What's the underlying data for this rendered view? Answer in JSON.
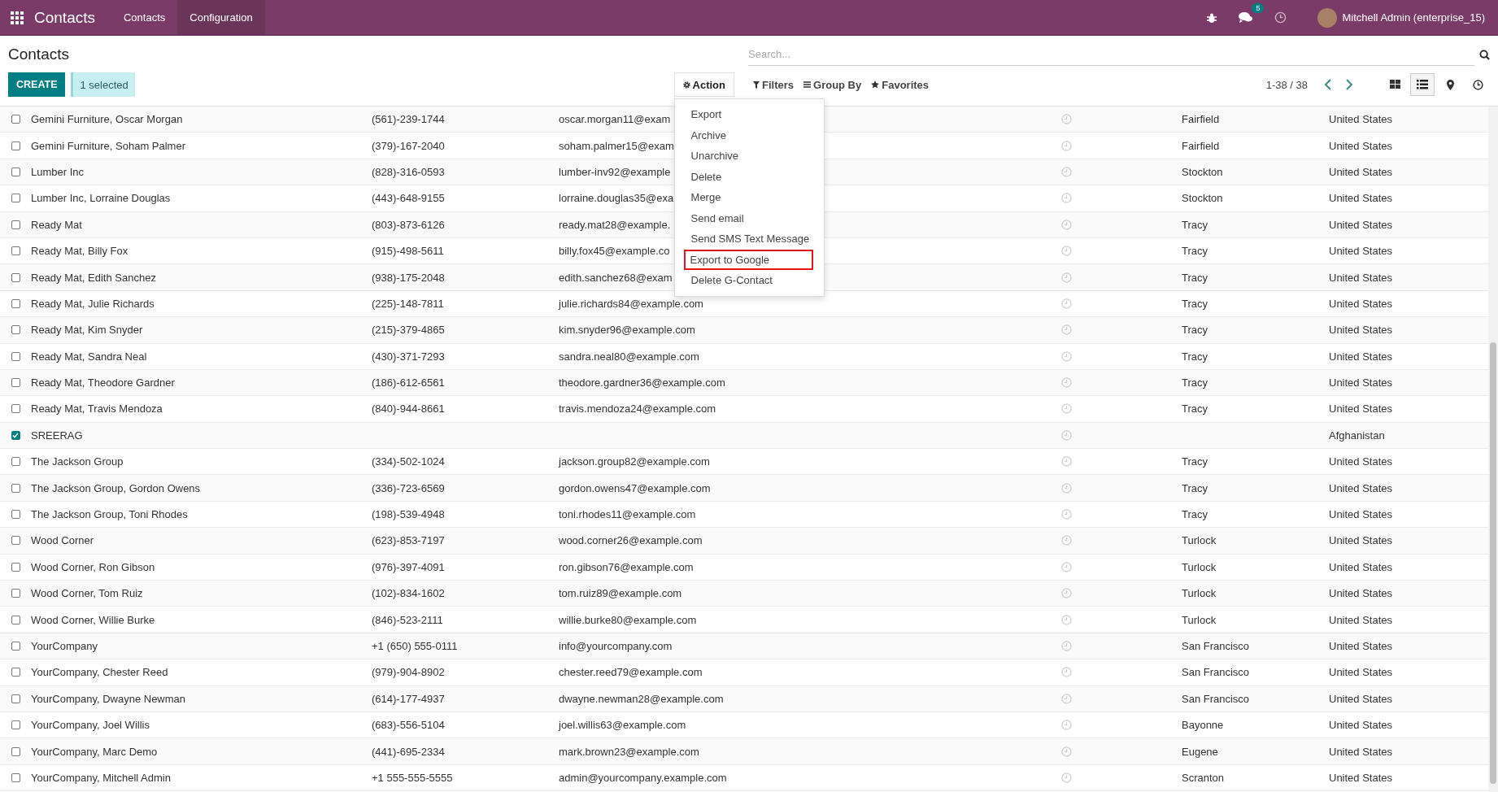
{
  "navbar": {
    "app_title": "Contacts",
    "menu": [
      {
        "label": "Contacts",
        "selected": false
      },
      {
        "label": "Configuration",
        "selected": true
      }
    ],
    "messages_badge": "5",
    "user_name": "Mitchell Admin (enterprise_15)"
  },
  "control_panel": {
    "title": "Contacts",
    "create_button": "CREATE",
    "selection": "1 selected",
    "action_button": "Action",
    "search": {
      "placeholder": "Search..."
    },
    "filters": [
      "Filters",
      "Group By",
      "Favorites"
    ],
    "pager": "1-38 / 38",
    "views": [
      {
        "kind": "kanban",
        "selected": false
      },
      {
        "kind": "list",
        "selected": true
      },
      {
        "kind": "map",
        "selected": false
      },
      {
        "kind": "activity",
        "selected": false
      }
    ]
  },
  "action_menu": {
    "items": [
      {
        "label": "Export",
        "highlighted": false
      },
      {
        "label": "Archive",
        "highlighted": false
      },
      {
        "label": "Unarchive",
        "highlighted": false
      },
      {
        "label": "Delete",
        "highlighted": false
      },
      {
        "label": "Merge",
        "highlighted": false
      },
      {
        "label": "Send email",
        "highlighted": false
      },
      {
        "label": "Send SMS Text Message",
        "highlighted": false
      },
      {
        "label": "Export to Google",
        "highlighted": true
      },
      {
        "label": "Delete G-Contact",
        "highlighted": false
      }
    ]
  },
  "table": {
    "rows": [
      {
        "checked": false,
        "name": "Gemini Furniture, Oscar Morgan",
        "phone": "(561)-239-1744",
        "email": "oscar.morgan11@exam",
        "city": "Fairfield",
        "country": "United States"
      },
      {
        "checked": false,
        "name": "Gemini Furniture, Soham Palmer",
        "phone": "(379)-167-2040",
        "email": "soham.palmer15@exam",
        "city": "Fairfield",
        "country": "United States"
      },
      {
        "checked": false,
        "name": "Lumber Inc",
        "phone": "(828)-316-0593",
        "email": "lumber-inv92@example",
        "city": "Stockton",
        "country": "United States"
      },
      {
        "checked": false,
        "name": "Lumber Inc, Lorraine Douglas",
        "phone": "(443)-648-9155",
        "email": "lorraine.douglas35@exa",
        "city": "Stockton",
        "country": "United States"
      },
      {
        "checked": false,
        "name": "Ready Mat",
        "phone": "(803)-873-6126",
        "email": "ready.mat28@example.",
        "city": "Tracy",
        "country": "United States"
      },
      {
        "checked": false,
        "name": "Ready Mat, Billy Fox",
        "phone": "(915)-498-5611",
        "email": "billy.fox45@example.co",
        "city": "Tracy",
        "country": "United States"
      },
      {
        "checked": false,
        "name": "Ready Mat, Edith Sanchez",
        "phone": "(938)-175-2048",
        "email": "edith.sanchez68@exam",
        "city": "Tracy",
        "country": "United States"
      },
      {
        "checked": false,
        "name": "Ready Mat, Julie Richards",
        "phone": "(225)-148-7811",
        "email": "julie.richards84@example.com",
        "city": "Tracy",
        "country": "United States"
      },
      {
        "checked": false,
        "name": "Ready Mat, Kim Snyder",
        "phone": "(215)-379-4865",
        "email": "kim.snyder96@example.com",
        "city": "Tracy",
        "country": "United States"
      },
      {
        "checked": false,
        "name": "Ready Mat, Sandra Neal",
        "phone": "(430)-371-7293",
        "email": "sandra.neal80@example.com",
        "city": "Tracy",
        "country": "United States"
      },
      {
        "checked": false,
        "name": "Ready Mat, Theodore Gardner",
        "phone": "(186)-612-6561",
        "email": "theodore.gardner36@example.com",
        "city": "Tracy",
        "country": "United States"
      },
      {
        "checked": false,
        "name": "Ready Mat, Travis Mendoza",
        "phone": "(840)-944-8661",
        "email": "travis.mendoza24@example.com",
        "city": "Tracy",
        "country": "United States"
      },
      {
        "checked": true,
        "name": "SREERAG",
        "country": "Afghanistan"
      },
      {
        "checked": false,
        "name": "The Jackson Group",
        "phone": "(334)-502-1024",
        "email": "jackson.group82@example.com",
        "city": "Tracy",
        "country": "United States"
      },
      {
        "checked": false,
        "name": "The Jackson Group, Gordon Owens",
        "phone": "(336)-723-6569",
        "email": "gordon.owens47@example.com",
        "city": "Tracy",
        "country": "United States"
      },
      {
        "checked": false,
        "name": "The Jackson Group, Toni Rhodes",
        "phone": "(198)-539-4948",
        "email": "toni.rhodes11@example.com",
        "city": "Tracy",
        "country": "United States"
      },
      {
        "checked": false,
        "name": "Wood Corner",
        "phone": "(623)-853-7197",
        "email": "wood.corner26@example.com",
        "city": "Turlock",
        "country": "United States"
      },
      {
        "checked": false,
        "name": "Wood Corner, Ron Gibson",
        "phone": "(976)-397-4091",
        "email": "ron.gibson76@example.com",
        "city": "Turlock",
        "country": "United States"
      },
      {
        "checked": false,
        "name": "Wood Corner, Tom Ruiz",
        "phone": "(102)-834-1602",
        "email": "tom.ruiz89@example.com",
        "city": "Turlock",
        "country": "United States"
      },
      {
        "checked": false,
        "name": "Wood Corner, Willie Burke",
        "phone": "(846)-523-2111",
        "email": "willie.burke80@example.com",
        "city": "Turlock",
        "country": "United States"
      },
      {
        "checked": false,
        "name": "YourCompany",
        "phone": "+1 (650) 555-0111",
        "email": "info@yourcompany.com",
        "city": "San Francisco",
        "country": "United States"
      },
      {
        "checked": false,
        "name": "YourCompany, Chester Reed",
        "phone": "(979)-904-8902",
        "email": "chester.reed79@example.com",
        "city": "San Francisco",
        "country": "United States"
      },
      {
        "checked": false,
        "name": "YourCompany, Dwayne Newman",
        "phone": "(614)-177-4937",
        "email": "dwayne.newman28@example.com",
        "city": "San Francisco",
        "country": "United States"
      },
      {
        "checked": false,
        "name": "YourCompany, Joel Willis",
        "phone": "(683)-556-5104",
        "email": "joel.willis63@example.com",
        "city": "Bayonne",
        "country": "United States"
      },
      {
        "checked": false,
        "name": "YourCompany, Marc Demo",
        "phone": "(441)-695-2334",
        "email": "mark.brown23@example.com",
        "city": "Eugene",
        "country": "United States"
      },
      {
        "checked": false,
        "name": "YourCompany, Mitchell Admin",
        "phone": "+1 555-555-5555",
        "email": "admin@yourcompany.example.com",
        "city": "Scranton",
        "country": "United States"
      }
    ]
  }
}
